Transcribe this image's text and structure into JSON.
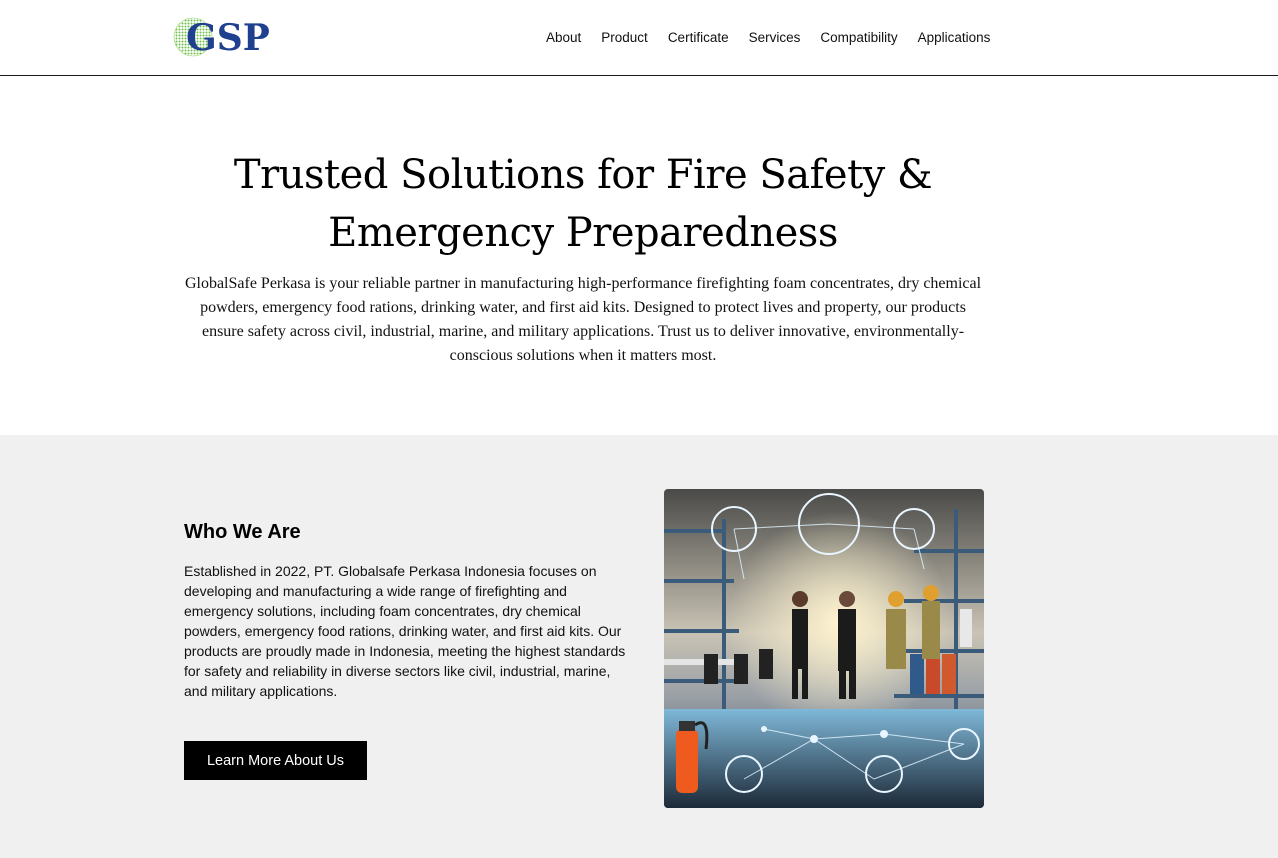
{
  "brand": {
    "logo_text": "GSP"
  },
  "nav": {
    "items": [
      {
        "label": "About"
      },
      {
        "label": "Product"
      },
      {
        "label": "Certificate"
      },
      {
        "label": "Services"
      },
      {
        "label": "Compatibility"
      },
      {
        "label": "Applications"
      }
    ]
  },
  "hero": {
    "title": "Trusted Solutions for Fire Safety & Emergency Preparedness",
    "description": "GlobalSafe Perkasa is your reliable partner in manufacturing high-performance firefighting foam concentrates, dry chemical powders, emergency food rations, drinking water, and first aid kits. Designed to protect lives and property, our products ensure safety across civil, industrial, marine, and military applications. Trust us to deliver innovative, environmentally-conscious solutions when it matters most."
  },
  "about": {
    "title": "Who We Are",
    "text": "Established in 2022, PT. Globalsafe Perkasa Indonesia focuses on developing and manufacturing a wide range of firefighting and emergency solutions, including foam concentrates, dry chemical powders, emergency food rations, drinking water, and first aid kits. Our products are proudly made in Indonesia, meeting the highest standards for safety and reliability in diverse sectors like civil, industrial, marine, and military applications.",
    "button_label": "Learn More About Us"
  },
  "colors": {
    "brand_blue": "#1f3f8f",
    "brand_green": "#6cbf4a",
    "section_bg": "#f0f0f0",
    "button_bg": "#000000"
  }
}
